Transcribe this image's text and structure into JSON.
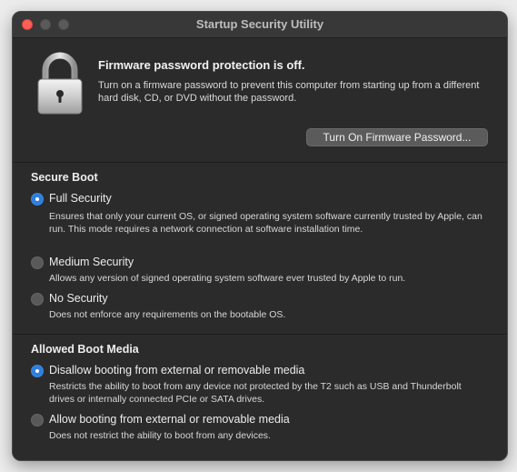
{
  "window": {
    "title": "Startup Security Utility"
  },
  "firmware": {
    "icon": "padlock-icon",
    "heading": "Firmware password protection is off.",
    "description": "Turn on a firmware password to prevent this computer from starting up from a different hard disk, CD, or DVD without the password.",
    "button_label": "Turn On Firmware Password..."
  },
  "secure_boot": {
    "title": "Secure Boot",
    "selected": "Full Security",
    "options": [
      {
        "label": "Full Security",
        "description": "Ensures that only your current OS, or signed operating system software currently trusted by Apple, can run. This mode requires a network connection at software installation time.",
        "selected": true
      },
      {
        "label": "Medium Security",
        "description": "Allows any version of signed operating system software ever trusted by Apple to run.",
        "selected": false
      },
      {
        "label": "No Security",
        "description": "Does not enforce any requirements on the bootable OS.",
        "selected": false
      }
    ]
  },
  "boot_media": {
    "title": "Allowed Boot Media",
    "selected": "Disallow booting from external or removable media",
    "options": [
      {
        "label": "Disallow booting from external or removable media",
        "description": "Restricts the ability to boot from any device not protected by the T2 such as USB and Thunderbolt drives or internally connected PCIe or SATA drives.",
        "selected": true
      },
      {
        "label": "Allow booting from external or removable media",
        "description": "Does not restrict the ability to boot from any devices.",
        "selected": false
      }
    ]
  },
  "colors": {
    "accent": "#2f7fe0",
    "window_background": "#2b2b2b",
    "close_button": "#fe5f57"
  }
}
